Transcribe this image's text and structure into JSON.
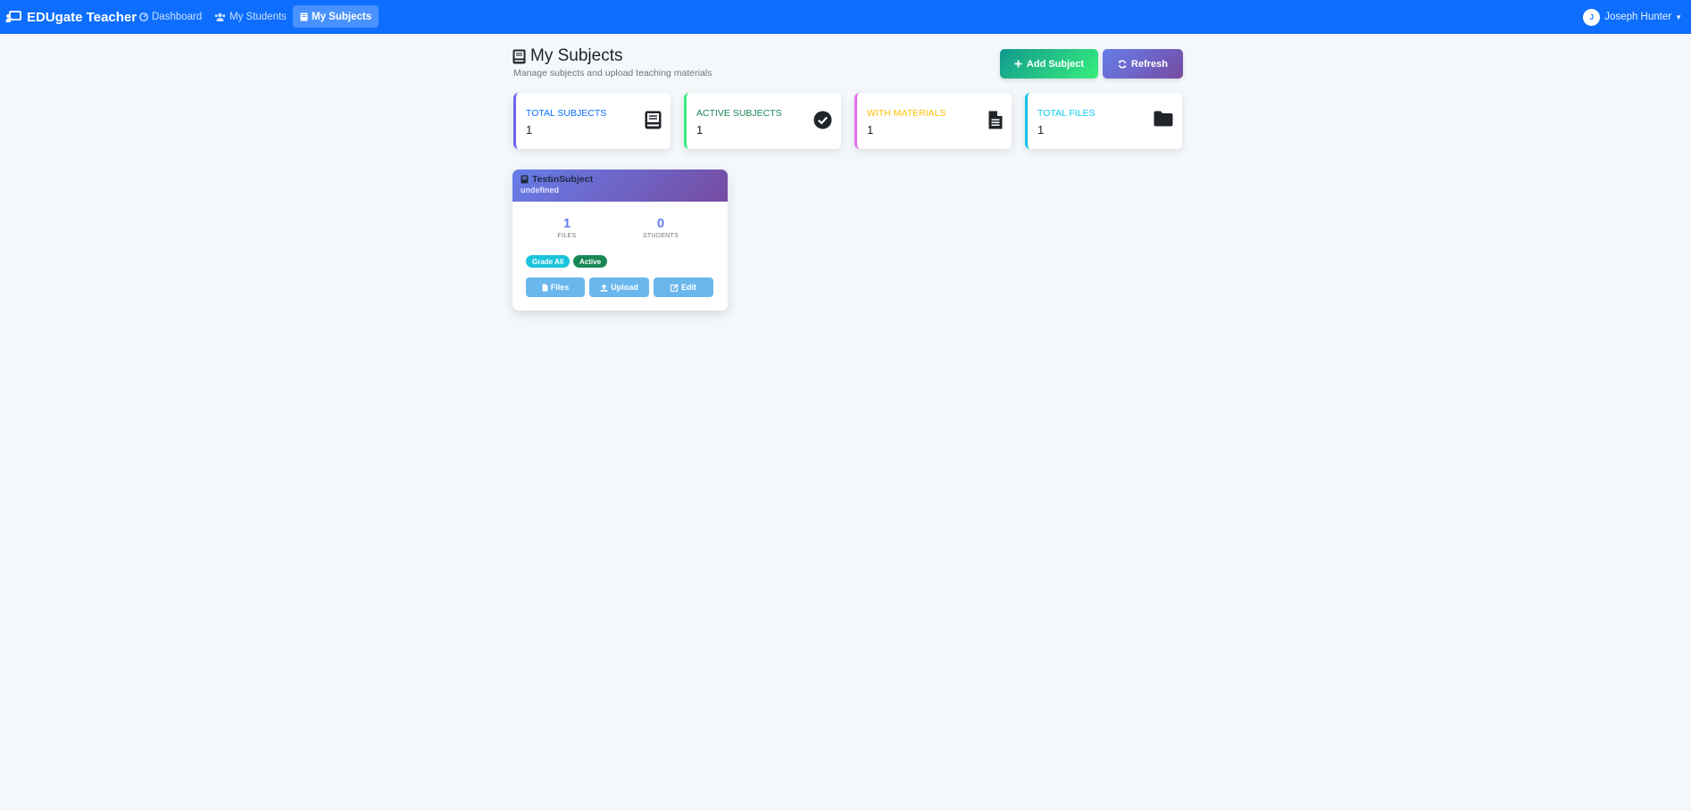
{
  "app": {
    "brand": "EDUgate Teacher"
  },
  "nav": {
    "items": [
      {
        "label": "Dashboard",
        "icon": "dashboard-icon",
        "active": false
      },
      {
        "label": "My Students",
        "icon": "users-icon",
        "active": false
      },
      {
        "label": "My Subjects",
        "icon": "book-icon",
        "active": true
      }
    ]
  },
  "user": {
    "initial": "J",
    "name": "Joseph Hunter"
  },
  "header": {
    "title": "My Subjects",
    "subtitle": "Manage subjects and upload teaching materials",
    "add_label": "Add Subject",
    "refresh_label": "Refresh"
  },
  "stats": [
    {
      "label": "TOTAL SUBJECTS",
      "value": "1",
      "color": "#0d6efd",
      "icon": "book-icon"
    },
    {
      "label": "ACTIVE SUBJECTS",
      "value": "1",
      "color": "#198754",
      "icon": "check-circle-icon"
    },
    {
      "label": "WITH MATERIALS",
      "value": "1",
      "color": "#ffc107",
      "icon": "file-icon"
    },
    {
      "label": "TOTAL FILES",
      "value": "1",
      "color": "#0dcaf0",
      "icon": "folder-icon"
    }
  ],
  "stat_border_colors": [
    "#6f63f2",
    "#38ef7d",
    "#e56ef0",
    "#17c1e8"
  ],
  "subjects": [
    {
      "name": "TestinSubject",
      "description": "undefined",
      "files_count": "1",
      "files_caption": "FILES",
      "students_count": "0",
      "students_caption": "STUDENTS",
      "grade_badge": "Grade All",
      "status_badge": "Active",
      "files_button": "Files",
      "upload_button": "Upload",
      "edit_button": "Edit"
    }
  ]
}
